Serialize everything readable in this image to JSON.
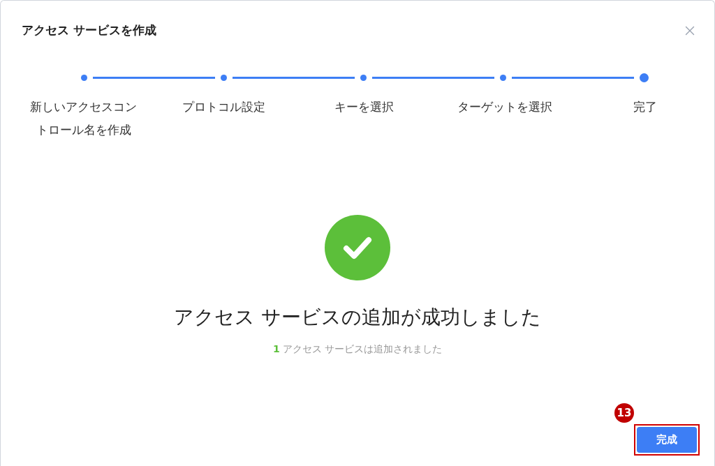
{
  "dialog": {
    "title": "アクセス サービスを作成"
  },
  "steps": [
    {
      "label": "新しいアクセスコントロール名を作成",
      "current": false
    },
    {
      "label": "プロトコル設定",
      "current": false
    },
    {
      "label": "キーを選択",
      "current": false
    },
    {
      "label": "ターゲットを選択",
      "current": false
    },
    {
      "label": "完了",
      "current": true
    }
  ],
  "result": {
    "heading": "アクセス サービスの追加が成功しました",
    "count": "1",
    "text": "アクセス サービスは追加されました"
  },
  "callout": {
    "number": "13"
  },
  "buttons": [
    {
      "label": "完成",
      "highlighted": true
    }
  ]
}
